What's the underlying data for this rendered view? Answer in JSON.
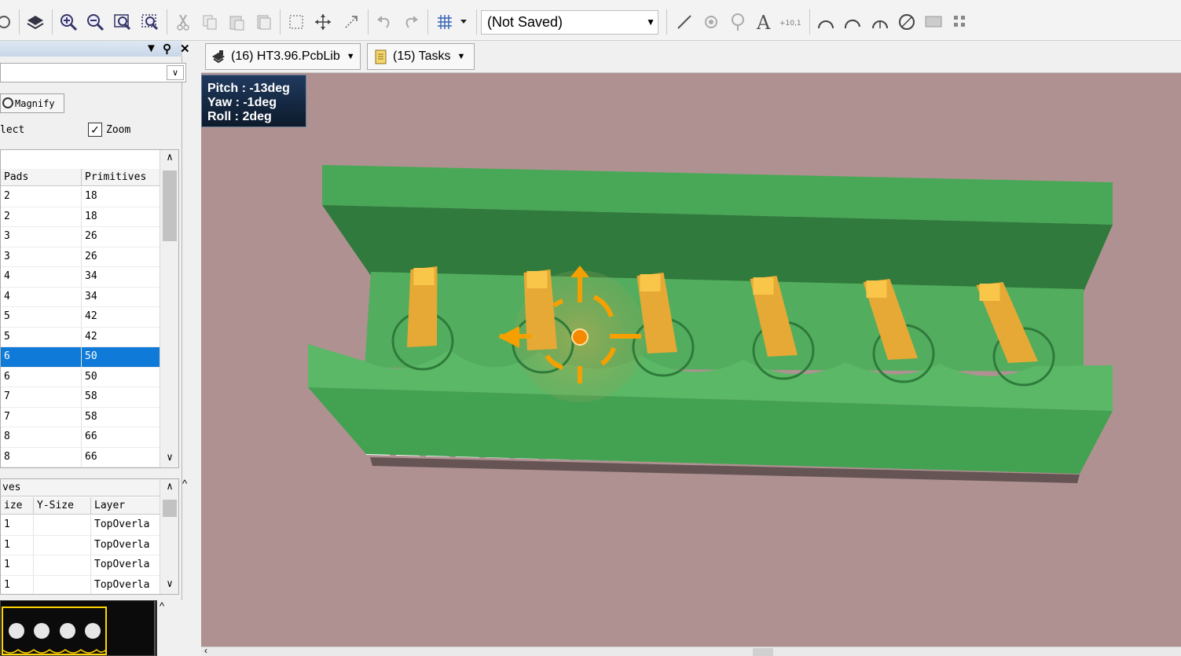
{
  "toolbar": {
    "document_combo": "(Not Saved)",
    "icons": [
      "print-preview-icon",
      "layers-icon",
      "zoom-in-icon",
      "zoom-out-icon",
      "zoom-fit-icon",
      "zoom-selection-icon",
      "cut-icon",
      "copy-icon",
      "paste-icon",
      "rubber-stamp-icon",
      "select-rect-icon",
      "move-icon",
      "cross-select-icon",
      "undo-icon",
      "redo-icon",
      "grid-icon",
      "line-icon",
      "pad-icon",
      "via-icon",
      "string-icon",
      "coordinate-icon",
      "arc-center-icon",
      "arc-edge-icon",
      "arc-any-icon",
      "full-circle-icon",
      "fill-icon",
      "array-icon"
    ]
  },
  "left_panel": {
    "pin_icon": "pin-icon",
    "close_icon": "close-icon",
    "magnify_label": "Magnify",
    "select_label": "lect",
    "zoom_label": "Zoom",
    "zoom_checked": true,
    "components_table": {
      "columns": [
        "Pads",
        "Primitives"
      ],
      "rows": [
        {
          "pads": "2",
          "primitives": "18"
        },
        {
          "pads": "2",
          "primitives": "18"
        },
        {
          "pads": "3",
          "primitives": "26"
        },
        {
          "pads": "3",
          "primitives": "26"
        },
        {
          "pads": "4",
          "primitives": "34"
        },
        {
          "pads": "4",
          "primitives": "34"
        },
        {
          "pads": "5",
          "primitives": "42"
        },
        {
          "pads": "5",
          "primitives": "42"
        },
        {
          "pads": "6",
          "primitives": "50"
        },
        {
          "pads": "6",
          "primitives": "50"
        },
        {
          "pads": "7",
          "primitives": "58"
        },
        {
          "pads": "7",
          "primitives": "58"
        },
        {
          "pads": "8",
          "primitives": "66"
        },
        {
          "pads": "8",
          "primitives": "66"
        }
      ],
      "selected_row": 8
    },
    "primitives_section": {
      "title": "ves",
      "columns": [
        "ize",
        "Y-Size",
        "Layer"
      ],
      "rows": [
        {
          "xsize": "1",
          "ysize": "",
          "layer": "TopOverla"
        },
        {
          "xsize": "1",
          "ysize": "",
          "layer": "TopOverla"
        },
        {
          "xsize": "1",
          "ysize": "",
          "layer": "TopOverla"
        },
        {
          "xsize": "1",
          "ysize": "",
          "layer": "TopOverla"
        }
      ]
    }
  },
  "tabs": [
    {
      "label": "(16) HT3.96.PcbLib",
      "icon": "pcblib-icon"
    },
    {
      "label": "(15) Tasks",
      "icon": "tasks-icon"
    }
  ],
  "view3d": {
    "pitch": "Pitch : -13deg",
    "yaw": "Yaw : -1deg",
    "roll": "Roll : 2deg",
    "pins": 6,
    "colors": {
      "background": "#af9191",
      "body": "#4fae5b",
      "pin": "#e6a935",
      "cursor": "#f5a000"
    }
  }
}
